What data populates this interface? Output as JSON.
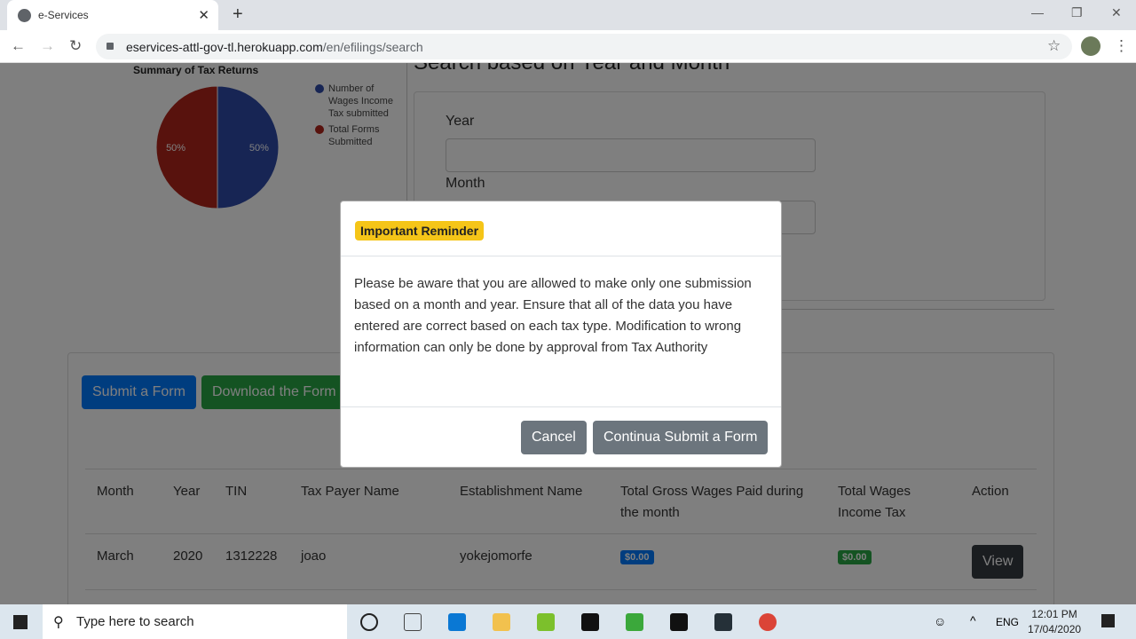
{
  "browser": {
    "tab_title": "e-Services",
    "url_host": "eservices-attl-gov-tl.herokuapp.com",
    "url_path": "/en/efilings/search"
  },
  "chart_data": {
    "type": "pie",
    "title": "Summary of Tax Returns",
    "legend_position": "right",
    "slices": [
      {
        "name": "Number of Wages Income Tax submitted",
        "value": 50,
        "label": "50%",
        "color": "#2f4aa8"
      },
      {
        "name": "Total Forms Submitted",
        "value": 50,
        "label": "50%",
        "color": "#b0241a"
      }
    ]
  },
  "search": {
    "title": "Search based on Year and Month",
    "year_label": "Year",
    "month_label": "Month",
    "year_value": "",
    "month_value": ""
  },
  "actions": {
    "submit": "Submit a Form",
    "download": "Download the Form"
  },
  "table": {
    "headers": [
      "Month",
      "Year",
      "TIN",
      "Tax Payer Name",
      "Establishment Name",
      "Total Gross Wages Paid during the month",
      "Total Wages Income Tax",
      "Action"
    ],
    "rows": [
      {
        "month": "March",
        "year": "2020",
        "tin": "1312228",
        "name": "joao",
        "establishment": "yokejomorfe",
        "gross": "$0.00",
        "tax": "$0.00",
        "action": "View"
      }
    ]
  },
  "modal": {
    "title": "Important Reminder",
    "body": "Please be aware that you are allowed to make only one submission based on a month and year. Ensure that all of the data you have entered are correct based on each tax type. Modification to wrong information can only be done by approval from Tax Authority",
    "cancel": "Cancel",
    "confirm": "Continua Submit a Form"
  },
  "taskbar": {
    "search_placeholder": "Type here to search",
    "lang": "ENG",
    "time": "12:01 PM",
    "date": "17/04/2020"
  }
}
